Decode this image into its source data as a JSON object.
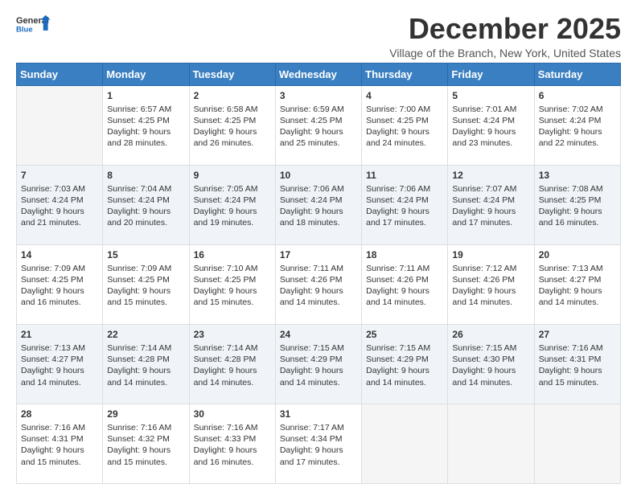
{
  "header": {
    "logo": {
      "line1": "General",
      "line2": "Blue"
    },
    "title": "December 2025",
    "subtitle": "Village of the Branch, New York, United States"
  },
  "calendar": {
    "days_of_week": [
      "Sunday",
      "Monday",
      "Tuesday",
      "Wednesday",
      "Thursday",
      "Friday",
      "Saturday"
    ],
    "weeks": [
      [
        {
          "day": "",
          "sunrise": "",
          "sunset": "",
          "daylight": ""
        },
        {
          "day": "1",
          "sunrise": "Sunrise: 6:57 AM",
          "sunset": "Sunset: 4:25 PM",
          "daylight": "Daylight: 9 hours and 28 minutes."
        },
        {
          "day": "2",
          "sunrise": "Sunrise: 6:58 AM",
          "sunset": "Sunset: 4:25 PM",
          "daylight": "Daylight: 9 hours and 26 minutes."
        },
        {
          "day": "3",
          "sunrise": "Sunrise: 6:59 AM",
          "sunset": "Sunset: 4:25 PM",
          "daylight": "Daylight: 9 hours and 25 minutes."
        },
        {
          "day": "4",
          "sunrise": "Sunrise: 7:00 AM",
          "sunset": "Sunset: 4:25 PM",
          "daylight": "Daylight: 9 hours and 24 minutes."
        },
        {
          "day": "5",
          "sunrise": "Sunrise: 7:01 AM",
          "sunset": "Sunset: 4:24 PM",
          "daylight": "Daylight: 9 hours and 23 minutes."
        },
        {
          "day": "6",
          "sunrise": "Sunrise: 7:02 AM",
          "sunset": "Sunset: 4:24 PM",
          "daylight": "Daylight: 9 hours and 22 minutes."
        }
      ],
      [
        {
          "day": "7",
          "sunrise": "Sunrise: 7:03 AM",
          "sunset": "Sunset: 4:24 PM",
          "daylight": "Daylight: 9 hours and 21 minutes."
        },
        {
          "day": "8",
          "sunrise": "Sunrise: 7:04 AM",
          "sunset": "Sunset: 4:24 PM",
          "daylight": "Daylight: 9 hours and 20 minutes."
        },
        {
          "day": "9",
          "sunrise": "Sunrise: 7:05 AM",
          "sunset": "Sunset: 4:24 PM",
          "daylight": "Daylight: 9 hours and 19 minutes."
        },
        {
          "day": "10",
          "sunrise": "Sunrise: 7:06 AM",
          "sunset": "Sunset: 4:24 PM",
          "daylight": "Daylight: 9 hours and 18 minutes."
        },
        {
          "day": "11",
          "sunrise": "Sunrise: 7:06 AM",
          "sunset": "Sunset: 4:24 PM",
          "daylight": "Daylight: 9 hours and 17 minutes."
        },
        {
          "day": "12",
          "sunrise": "Sunrise: 7:07 AM",
          "sunset": "Sunset: 4:24 PM",
          "daylight": "Daylight: 9 hours and 17 minutes."
        },
        {
          "day": "13",
          "sunrise": "Sunrise: 7:08 AM",
          "sunset": "Sunset: 4:25 PM",
          "daylight": "Daylight: 9 hours and 16 minutes."
        }
      ],
      [
        {
          "day": "14",
          "sunrise": "Sunrise: 7:09 AM",
          "sunset": "Sunset: 4:25 PM",
          "daylight": "Daylight: 9 hours and 16 minutes."
        },
        {
          "day": "15",
          "sunrise": "Sunrise: 7:09 AM",
          "sunset": "Sunset: 4:25 PM",
          "daylight": "Daylight: 9 hours and 15 minutes."
        },
        {
          "day": "16",
          "sunrise": "Sunrise: 7:10 AM",
          "sunset": "Sunset: 4:25 PM",
          "daylight": "Daylight: 9 hours and 15 minutes."
        },
        {
          "day": "17",
          "sunrise": "Sunrise: 7:11 AM",
          "sunset": "Sunset: 4:26 PM",
          "daylight": "Daylight: 9 hours and 14 minutes."
        },
        {
          "day": "18",
          "sunrise": "Sunrise: 7:11 AM",
          "sunset": "Sunset: 4:26 PM",
          "daylight": "Daylight: 9 hours and 14 minutes."
        },
        {
          "day": "19",
          "sunrise": "Sunrise: 7:12 AM",
          "sunset": "Sunset: 4:26 PM",
          "daylight": "Daylight: 9 hours and 14 minutes."
        },
        {
          "day": "20",
          "sunrise": "Sunrise: 7:13 AM",
          "sunset": "Sunset: 4:27 PM",
          "daylight": "Daylight: 9 hours and 14 minutes."
        }
      ],
      [
        {
          "day": "21",
          "sunrise": "Sunrise: 7:13 AM",
          "sunset": "Sunset: 4:27 PM",
          "daylight": "Daylight: 9 hours and 14 minutes."
        },
        {
          "day": "22",
          "sunrise": "Sunrise: 7:14 AM",
          "sunset": "Sunset: 4:28 PM",
          "daylight": "Daylight: 9 hours and 14 minutes."
        },
        {
          "day": "23",
          "sunrise": "Sunrise: 7:14 AM",
          "sunset": "Sunset: 4:28 PM",
          "daylight": "Daylight: 9 hours and 14 minutes."
        },
        {
          "day": "24",
          "sunrise": "Sunrise: 7:15 AM",
          "sunset": "Sunset: 4:29 PM",
          "daylight": "Daylight: 9 hours and 14 minutes."
        },
        {
          "day": "25",
          "sunrise": "Sunrise: 7:15 AM",
          "sunset": "Sunset: 4:29 PM",
          "daylight": "Daylight: 9 hours and 14 minutes."
        },
        {
          "day": "26",
          "sunrise": "Sunrise: 7:15 AM",
          "sunset": "Sunset: 4:30 PM",
          "daylight": "Daylight: 9 hours and 14 minutes."
        },
        {
          "day": "27",
          "sunrise": "Sunrise: 7:16 AM",
          "sunset": "Sunset: 4:31 PM",
          "daylight": "Daylight: 9 hours and 15 minutes."
        }
      ],
      [
        {
          "day": "28",
          "sunrise": "Sunrise: 7:16 AM",
          "sunset": "Sunset: 4:31 PM",
          "daylight": "Daylight: 9 hours and 15 minutes."
        },
        {
          "day": "29",
          "sunrise": "Sunrise: 7:16 AM",
          "sunset": "Sunset: 4:32 PM",
          "daylight": "Daylight: 9 hours and 15 minutes."
        },
        {
          "day": "30",
          "sunrise": "Sunrise: 7:16 AM",
          "sunset": "Sunset: 4:33 PM",
          "daylight": "Daylight: 9 hours and 16 minutes."
        },
        {
          "day": "31",
          "sunrise": "Sunrise: 7:17 AM",
          "sunset": "Sunset: 4:34 PM",
          "daylight": "Daylight: 9 hours and 17 minutes."
        },
        {
          "day": "",
          "sunrise": "",
          "sunset": "",
          "daylight": ""
        },
        {
          "day": "",
          "sunrise": "",
          "sunset": "",
          "daylight": ""
        },
        {
          "day": "",
          "sunrise": "",
          "sunset": "",
          "daylight": ""
        }
      ]
    ]
  }
}
